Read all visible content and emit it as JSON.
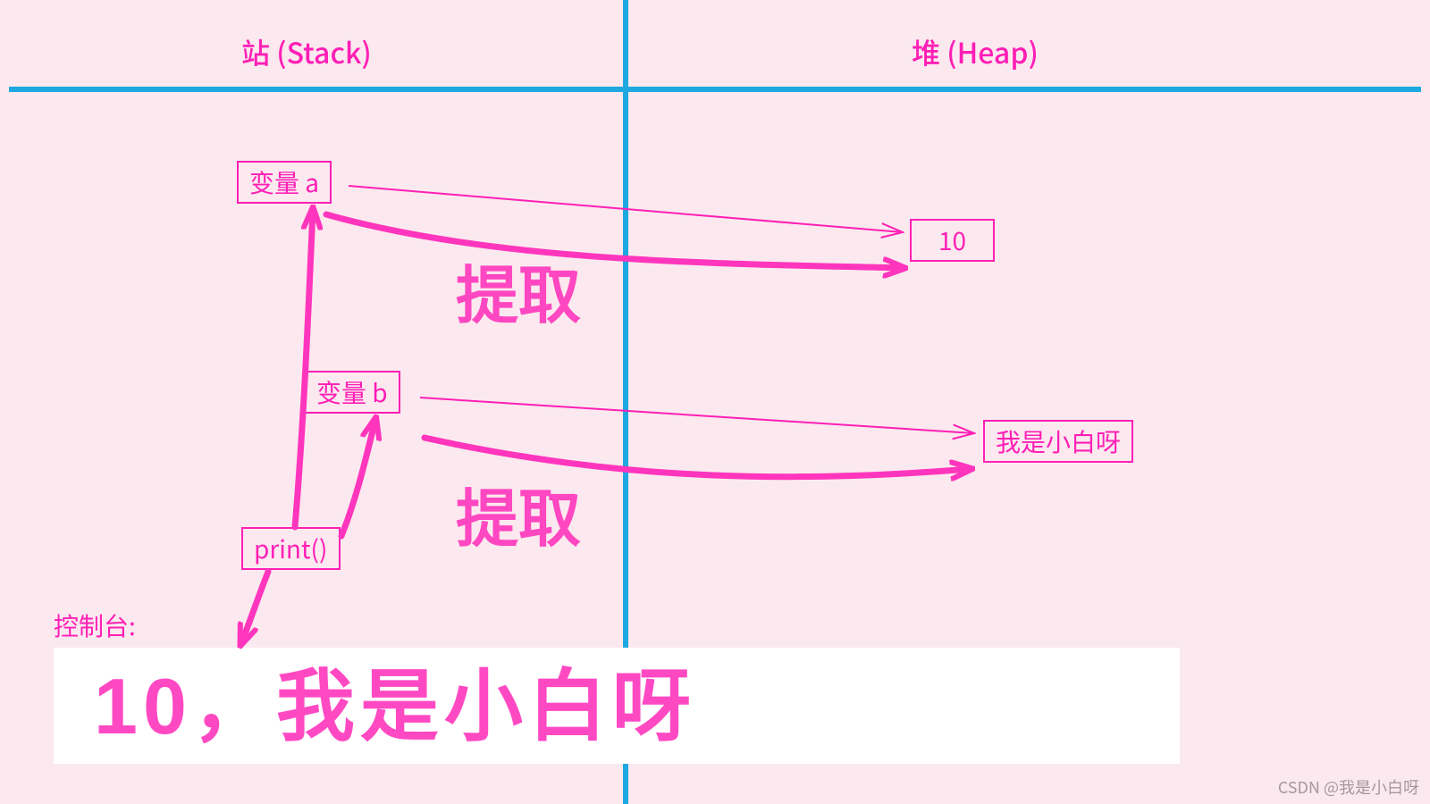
{
  "headers": {
    "stack": "站 (Stack)",
    "heap": "堆 (Heap)"
  },
  "stack": {
    "var_a": "变量 a",
    "var_b": "变量 b",
    "print": "print()"
  },
  "heap": {
    "val_a": "10",
    "val_b": "我是小白呀"
  },
  "annotations": {
    "extract1": "提取",
    "extract2": "提取",
    "console_label": "控制台:"
  },
  "console_output": "10，我是小白呀",
  "watermark": "CSDN @我是小白呀",
  "colors": {
    "divider": "#1fa8e0",
    "ink": "#ff1fb6",
    "handwriting": "#ff36bd",
    "bg": "#fbe9ef"
  }
}
